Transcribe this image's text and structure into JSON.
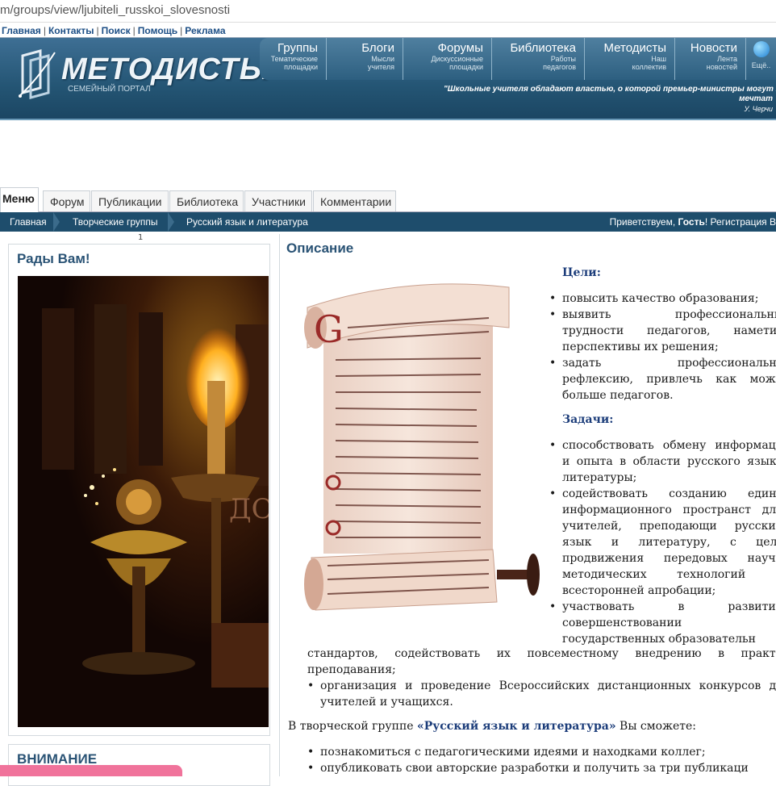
{
  "browser": {
    "url": "m/groups/view/ljubiteli_russkoi_slovesnosti"
  },
  "toplinks": [
    "Главная",
    "Контакты",
    "Поиск",
    "Помощь",
    "Реклама"
  ],
  "header": {
    "logo_text": "МЕТОДИСТЫ",
    "logo_sub": "СЕМЕЙНЫЙ ПОРТАЛ",
    "nav": [
      {
        "title": "Группы",
        "sub1": "Тематические",
        "sub2": "площадки"
      },
      {
        "title": "Блоги",
        "sub1": "Мысли",
        "sub2": "учителя"
      },
      {
        "title": "Форумы",
        "sub1": "Дискуссионные",
        "sub2": "площадки"
      },
      {
        "title": "Библиотека",
        "sub1": "Работы",
        "sub2": "педагогов"
      },
      {
        "title": "Методисты",
        "sub1": "Наш",
        "sub2": "коллектив"
      },
      {
        "title": "Новости",
        "sub1": "Лента",
        "sub2": "новостей"
      }
    ],
    "more_label": "Ещё..",
    "quote_line1": "\"Школьные учителя обладают властью, о которой премьер-министры могут тол",
    "quote_line2": "мечтат",
    "quote_author": "У. Черчи"
  },
  "tabs": [
    "Меню",
    "Форум",
    "Публикации",
    "Библиотека",
    "Участники",
    "Комментарии"
  ],
  "breadcrumbs": [
    "Главная",
    "Творческие группы",
    "Русский язык и литература"
  ],
  "greeting": {
    "prefix": "Приветствуем,",
    "guest": "Гость",
    "suffix": "! Регистрация В"
  },
  "page_number": "1",
  "left": {
    "welcome_title": "Рады Вам!",
    "attention_title": "ВНИМАНИЕ"
  },
  "right": {
    "title": "Описание",
    "goals_heading": "Цели:",
    "goals": [
      "повысить качество образования;",
      "выявить профессиональны трудности педагогов, наметит перспективы их решения;",
      "задать профессиональну рефлексию, привлечь как можн больше педагогов."
    ],
    "tasks_heading": "Задачи:",
    "tasks": [
      "способствовать обмену информаци и опыта в области русского языка литературы;",
      "содействовать созданию едино информационного пространст для учителей, преподающи русский язык и литературу, с цель продвижения передовых научн методических технологий и всесторонней апробации;",
      "участвовать в развитии совершенствовании государственных образовательн"
    ],
    "tasks_tail": "стандартов, содействовать их повсеместному внедрению в практи преподавания;",
    "tasks_extra": [
      "организация и проведение Всероссийских дистанционных конкурсов дл учителей и учащихся."
    ],
    "intro_prefix": "В  творческой группе ",
    "intro_group": "«Русский язык и литература»",
    "intro_suffix": " Вы сможете:",
    "opportunities": [
      "познакомиться с педагогическими идеями и находками  коллег;",
      "опубликовать свои авторские разработки и получить за три публикаци"
    ]
  }
}
